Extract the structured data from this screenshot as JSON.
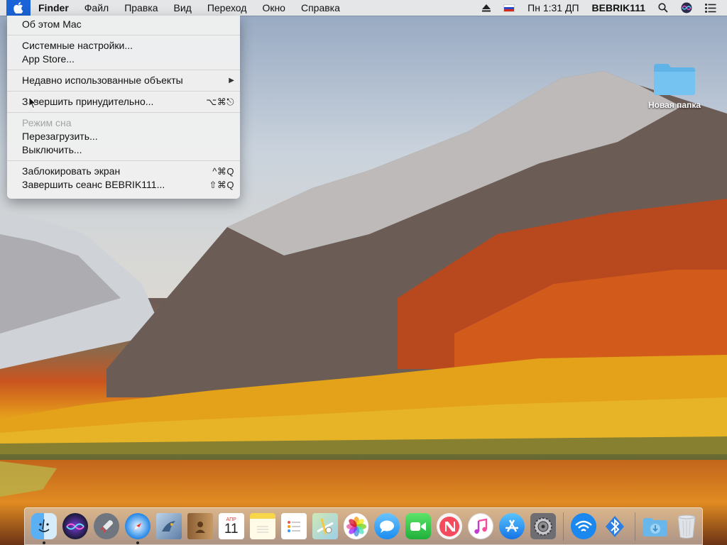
{
  "menubar": {
    "app_name": "Finder",
    "items": [
      "Файл",
      "Правка",
      "Вид",
      "Переход",
      "Окно",
      "Справка"
    ],
    "clock": "Пн 1:31 ДП",
    "user": "BEBRIK111"
  },
  "apple_menu": {
    "about": "Об этом Mac",
    "system_prefs": "Системные настройки...",
    "app_store": "App Store...",
    "recent_items": "Недавно использованные объекты",
    "force_quit": "Завершить принудительно...",
    "force_quit_shortcut": "⌥⌘⎋",
    "sleep": "Режим сна",
    "restart": "Перезагрузить...",
    "shutdown": "Выключить...",
    "lock_screen": "Заблокировать экран",
    "lock_screen_shortcut": "^⌘Q",
    "logout": "Завершить сеанс BEBRIK111...",
    "logout_shortcut": "⇧⌘Q"
  },
  "desktop": {
    "folder_label": "Новая папка"
  },
  "dock": {
    "calendar_month": "АПР",
    "calendar_day": "11",
    "apps": [
      "finder-icon",
      "siri-icon",
      "launchpad-icon",
      "safari-icon",
      "mail-icon",
      "contacts-icon",
      "calendar-icon",
      "notes-icon",
      "reminders-icon",
      "maps-icon",
      "photos-icon",
      "messages-icon",
      "facetime-icon",
      "news-icon",
      "itunes-icon",
      "app-store-icon",
      "system-preferences-icon",
      "wifi-icon",
      "bluetooth-icon",
      "downloads-folder-icon",
      "trash-icon"
    ]
  }
}
